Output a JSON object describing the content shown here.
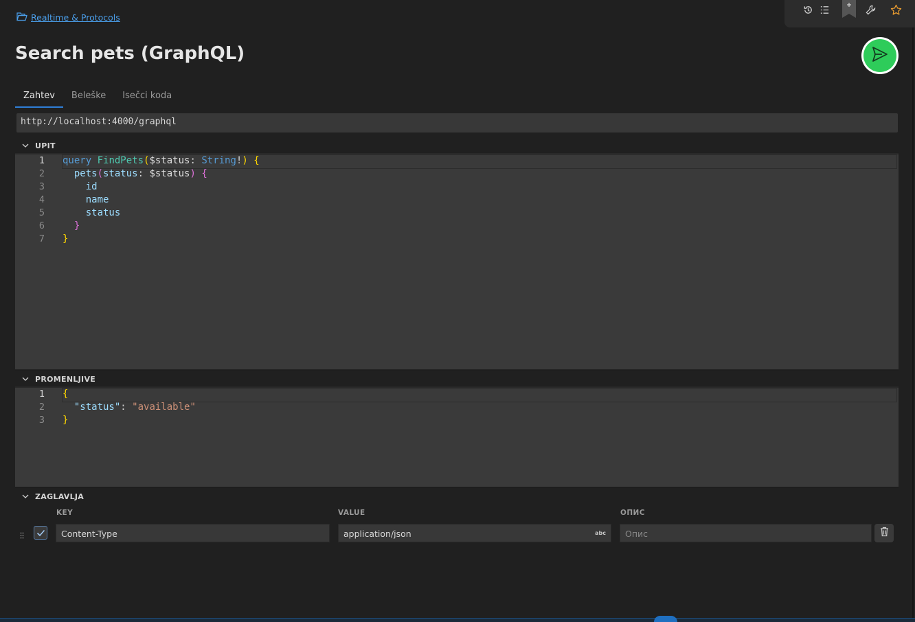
{
  "breadcrumb": {
    "label": "Realtime & Protocols"
  },
  "page": {
    "title": "Search pets (GraphQL)"
  },
  "toolbar": {
    "icons": [
      "history-icon",
      "list-icon",
      "bookmark-icon",
      "wrench-icon",
      "star-icon"
    ]
  },
  "tabs": [
    {
      "label": "Zahtev",
      "active": true
    },
    {
      "label": "Beleške",
      "active": false
    },
    {
      "label": "Isečci koda",
      "active": false
    }
  ],
  "url": "http://localhost:4000/graphql",
  "sections": {
    "query": {
      "label": "UPIT"
    },
    "variables": {
      "label": "PROMENLJIVE"
    },
    "headers": {
      "label": "ZAGLAVLJA"
    }
  },
  "query_lines": [
    {
      "n": "1",
      "text": "query FindPets($status: String!) {"
    },
    {
      "n": "2",
      "text": "  pets(status: $status) {"
    },
    {
      "n": "3",
      "text": "    id"
    },
    {
      "n": "4",
      "text": "    name"
    },
    {
      "n": "5",
      "text": "    status"
    },
    {
      "n": "6",
      "text": "  }"
    },
    {
      "n": "7",
      "text": "}"
    }
  ],
  "variable_lines": [
    {
      "n": "1",
      "text": "{"
    },
    {
      "n": "2",
      "text": "  \"status\": \"available\""
    },
    {
      "n": "3",
      "text": "}"
    }
  ],
  "headers": {
    "columns": {
      "key": "KEY",
      "value": "VALUE",
      "description": "ОПИС"
    },
    "rows": [
      {
        "enabled": true,
        "key": "Content-Type",
        "value": "application/json",
        "value_badge": "abc",
        "description_placeholder": "Опис"
      }
    ]
  },
  "colors": {
    "send_button": "#2ecc5a",
    "accent": "#2f7fd8",
    "link": "#4a9eea"
  }
}
